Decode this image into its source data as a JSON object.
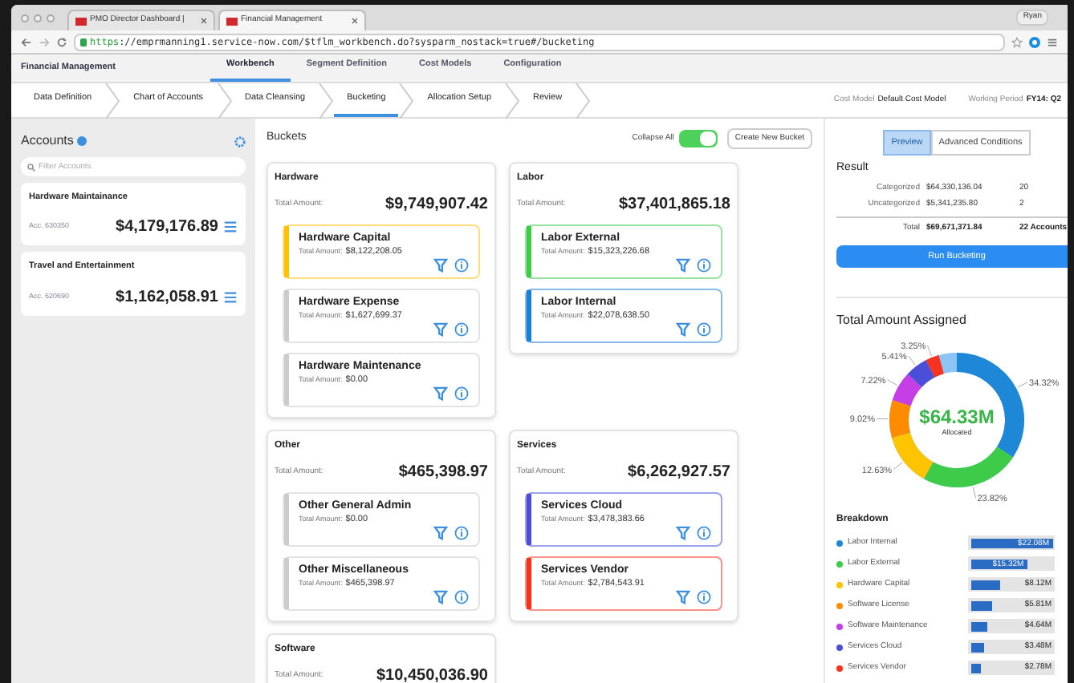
{
  "browser": {
    "tabs": [
      {
        "label": "PMO Director Dashboard | ",
        "selected": false
      },
      {
        "label": "Financial Management",
        "selected": true
      }
    ],
    "url": {
      "scheme": "https",
      "rest": "://emprmanning1.service-now.com/$tflm_workbench.do?sysparm_nostack=true#/bucketing"
    },
    "user": "Ryan"
  },
  "app_nav": {
    "title": "Financial Management",
    "items": [
      {
        "label": "Workbench",
        "selected": true
      },
      {
        "label": "Segment Definition",
        "selected": false
      },
      {
        "label": "Cost Models",
        "selected": false
      },
      {
        "label": "Configuration",
        "selected": false
      }
    ]
  },
  "steps": [
    {
      "label": "Data Definition",
      "selected": false
    },
    {
      "label": "Chart of Accounts",
      "selected": false
    },
    {
      "label": "Data Cleansing",
      "selected": false
    },
    {
      "label": "Bucketing",
      "selected": true
    },
    {
      "label": "Allocation Setup",
      "selected": false
    },
    {
      "label": "Review",
      "selected": false
    }
  ],
  "cost_model": {
    "label": "Cost Model",
    "value": "Default Cost Model"
  },
  "working_period": {
    "label": "Working Period",
    "value": "FY14: Q2"
  },
  "accounts": {
    "title": "Accounts",
    "placeholder": "Filter Accounts",
    "items": [
      {
        "name": "Hardware Maintainance",
        "number": "Acc. 630350",
        "amount": "$4,179,176.89"
      },
      {
        "name": "Travel and Entertainment",
        "number": "Acc. 620690",
        "amount": "$1,162,058.91"
      }
    ]
  },
  "buckets": {
    "title": "Buckets",
    "collapse_label": "Collapse All",
    "collapse_on": true,
    "create_button": "Create New Bucket",
    "groups": [
      {
        "name": "Hardware",
        "total_label": "Total Amount:",
        "total": "$9,749,907.42",
        "items": [
          {
            "name": "Hardware Capital",
            "total_label": "Total Amount:",
            "amount": "$8,122,208.05",
            "color": "#ffc107"
          },
          {
            "name": "Hardware Expense",
            "total_label": "Total Amount:",
            "amount": "$1,627,699.37",
            "color": "#cccccc"
          },
          {
            "name": "Hardware Maintenance",
            "total_label": "Total Amount:",
            "amount": "$0.00",
            "color": "#cccccc"
          }
        ]
      },
      {
        "name": "Labor",
        "total_label": "Total Amount:",
        "total": "$37,401,865.18",
        "items": [
          {
            "name": "Labor External",
            "total_label": "Total Amount:",
            "amount": "$15,323,226.68",
            "color": "#3ecb4a"
          },
          {
            "name": "Labor Internal",
            "total_label": "Total Amount:",
            "amount": "$22,078,638.50",
            "color": "#1a7fd6"
          }
        ]
      },
      {
        "name": "Other",
        "total_label": "Total Amount:",
        "total": "$465,398.97",
        "items": [
          {
            "name": "Other General Admin",
            "total_label": "Total Amount:",
            "amount": "$0.00",
            "color": "#cccccc"
          },
          {
            "name": "Other Miscellaneous",
            "total_label": "Total Amount:",
            "amount": "$465,398.97",
            "color": "#cccccc"
          }
        ]
      },
      {
        "name": "Services",
        "total_label": "Total Amount:",
        "total": "$6,262,927.57",
        "items": [
          {
            "name": "Services Cloud",
            "total_label": "Total Amount:",
            "amount": "$3,478,383.66",
            "color": "#4b4fd8"
          },
          {
            "name": "Services Vendor",
            "total_label": "Total Amount:",
            "amount": "$2,784,543.91",
            "color": "#f5331f"
          }
        ]
      },
      {
        "name": "Software",
        "total_label": "Total Amount:",
        "total": "$10,450,036.90"
      }
    ]
  },
  "result": {
    "tabs": [
      {
        "label": "Preview",
        "selected": true
      },
      {
        "label": "Advanced Conditions",
        "selected": false
      }
    ],
    "title": "Result",
    "rows": [
      {
        "label": "Categorized",
        "amount": "$64,330,136.04",
        "count": "20"
      },
      {
        "label": "Uncategorized",
        "amount": "$5,341,235.80",
        "count": "2"
      }
    ],
    "total": {
      "label": "Total",
      "amount": "$69,671,371.84",
      "count": "22 Accounts"
    },
    "run_button": "Run Bucketing"
  },
  "assigned": {
    "title": "Total Amount Assigned",
    "center_value": "$64.33M",
    "center_label": "Allocated",
    "chart_data": {
      "type": "donut",
      "values": [
        34.32,
        23.82,
        12.63,
        9.02,
        7.22,
        5.41,
        3.25
      ],
      "value_labels": [
        "34.32%",
        "23.82%",
        "12.63%",
        "9.02%",
        "7.22%",
        "5.41%",
        "3.25%"
      ],
      "colors": [
        "#1e88d6",
        "#3ecb4a",
        "#ffc400",
        "#ff8c00",
        "#c63ee6",
        "#4b4fd8",
        "#f5331f"
      ]
    }
  },
  "breakdown": {
    "title": "Breakdown",
    "items": [
      {
        "name": "Labor Internal",
        "color": "#1e88d6",
        "value": "$22.08M",
        "level": 1
      },
      {
        "name": "Labor External",
        "color": "#3ecb4a",
        "value": "$15.32M",
        "level": 0.69
      },
      {
        "name": "Hardware Capital",
        "color": "#ffc400",
        "value": "$8.12M",
        "level": 0.37
      },
      {
        "name": "Software License",
        "color": "#ff8c00",
        "value": "$5.81M",
        "level": 0.26
      },
      {
        "name": "Software Maintenance",
        "color": "#c63ee6",
        "value": "$4.64M",
        "level": 0.21
      },
      {
        "name": "Services Cloud",
        "color": "#4b4fd8",
        "value": "$3.48M",
        "level": 0.16
      },
      {
        "name": "Services Vendor",
        "color": "#f5331f",
        "value": "$2.78M",
        "level": 0.13
      }
    ]
  }
}
